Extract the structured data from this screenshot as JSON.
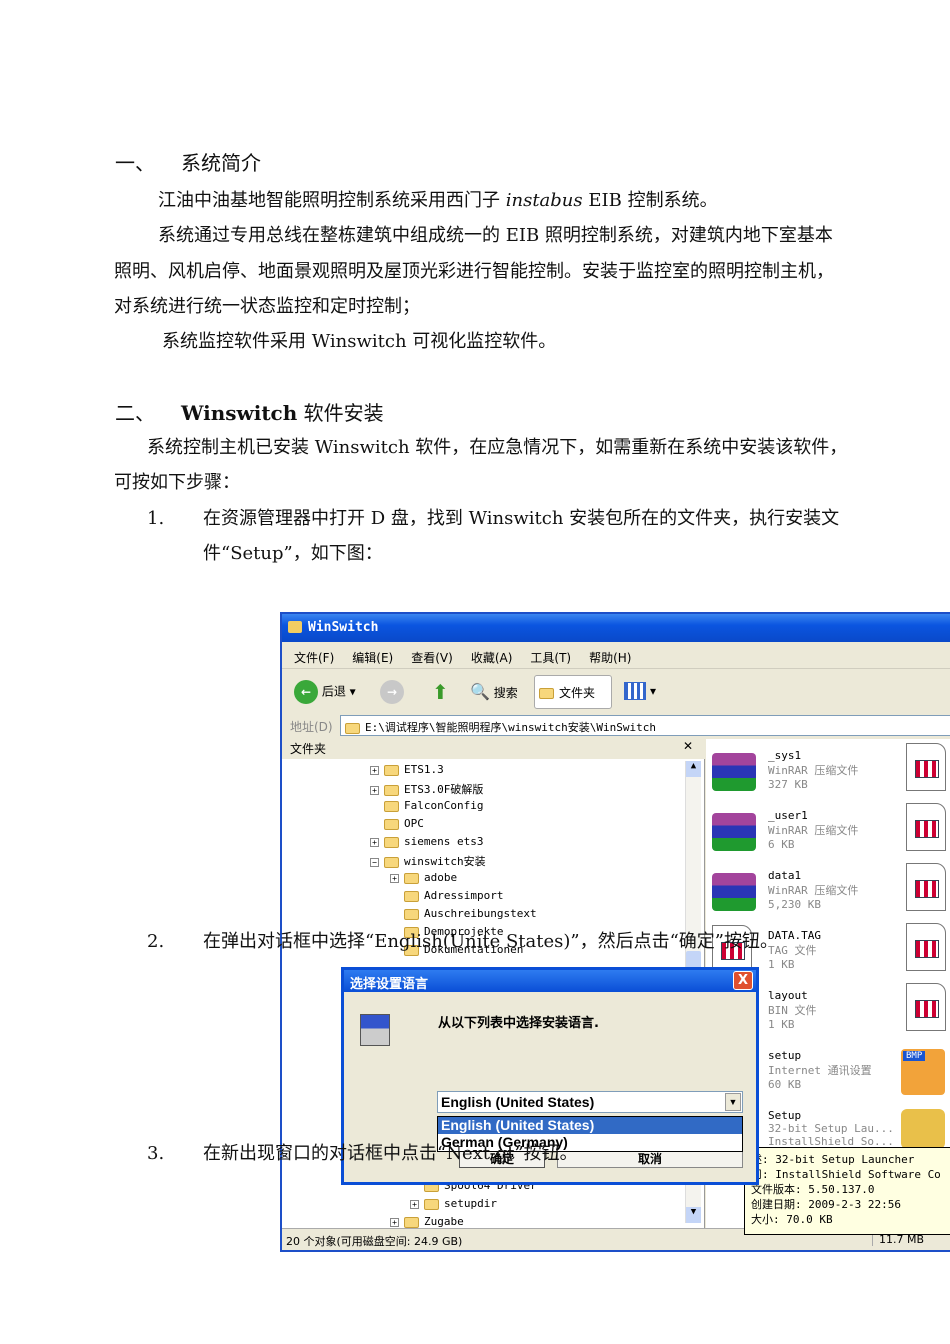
{
  "section1": {
    "num": "一、",
    "title": "系统简介",
    "p1_a": "江油中油基地智能照明控制系统采用西门子",
    "p1_i": "instabus",
    "p1_b": "EIB 控制系统。",
    "p2_l1": "系统通过专用总线在整栋建筑中组成统一的 EIB 照明控制系统，对建筑内地下室基本",
    "p2_l2": "照明、风机启停、地面景观照明及屋顶光彩进行智能控制。安装于监控室的照明控制主机，",
    "p2_l3": "对系统进行统一状态监控和定时控制；",
    "p3": "系统监控软件采用 Winswitch 可视化监控软件。"
  },
  "section2": {
    "num": "二、",
    "title_b": "Winswitch",
    "title": " 软件安装",
    "p1_l1": "系统控制主机已安装 Winswitch 软件，在应急情况下，如需重新在系统中安装该软件，",
    "p1_l2": "可按如下步骤：",
    "steps": [
      {
        "num": "1.",
        "l1": "在资源管理器中打开 D 盘，找到 Winswitch 安装包所在的文件夹，执行安装文",
        "l2": "件“Setup”，如下图："
      },
      {
        "num": "2.",
        "l1": "在弹出对话框中选择“English(Unite States)”，然后点击“确定”按钮。"
      },
      {
        "num": "3.",
        "l1": "在新出现窗口的对话框中点击“Next gt”按钮。"
      }
    ]
  },
  "explorer": {
    "title": "WinSwitch",
    "menu": [
      "文件(F)",
      "编辑(E)",
      "查看(V)",
      "收藏(A)",
      "工具(T)",
      "帮助(H)"
    ],
    "toolbar": {
      "back": "后退",
      "search": "搜索",
      "folders": "文件夹"
    },
    "address_label": "地址(D)",
    "address": "E:\\调试程序\\智能照明程序\\winswitch安装\\WinSwitch",
    "folders_pane_title": "文件夹",
    "tree": [
      {
        "label": "ETS1.3",
        "exp": "+",
        "lvl": 0
      },
      {
        "label": "ETS3.0F破解版",
        "exp": "+",
        "lvl": 0
      },
      {
        "label": "FalconConfig",
        "exp": "",
        "lvl": 0
      },
      {
        "label": "OPC",
        "exp": "",
        "lvl": 0
      },
      {
        "label": "siemens ets3",
        "exp": "+",
        "lvl": 0
      },
      {
        "label": "winswitch安装",
        "exp": "-",
        "lvl": 0
      },
      {
        "label": "adobe",
        "exp": "+",
        "lvl": 1
      },
      {
        "label": "Adressimport",
        "exp": "",
        "lvl": 1
      },
      {
        "label": "Auschreibungstext",
        "exp": "",
        "lvl": 1
      },
      {
        "label": "Demoprojekte",
        "exp": "",
        "lvl": 1
      },
      {
        "label": "Dokumentationen",
        "exp": "",
        "lvl": 1
      }
    ],
    "tree_bottom": [
      {
        "label": "Spool64 Driver",
        "exp": "",
        "lvl": 2
      },
      {
        "label": "setupdir",
        "exp": "+",
        "lvl": 2
      },
      {
        "label": "Zugabe",
        "exp": "+",
        "lvl": 1
      }
    ],
    "files": [
      {
        "name": "_sys1",
        "type": "WinRAR 压缩文件",
        "size": "327 KB",
        "icon": "rar"
      },
      {
        "name": "_user1",
        "type": "WinRAR 压缩文件",
        "size": "6 KB",
        "icon": "rar"
      },
      {
        "name": "data1",
        "type": "WinRAR 压缩文件",
        "size": "5,230 KB",
        "icon": "rar"
      },
      {
        "name": "DATA.TAG",
        "type": "TAG 文件",
        "size": "1 KB",
        "icon": "doc"
      },
      {
        "name": "layout",
        "type": "BIN 文件",
        "size": "1 KB",
        "icon": "doc"
      },
      {
        "name": "setup",
        "type": "Internet 通讯设置",
        "size": "60 KB",
        "icon": "bmp"
      },
      {
        "name": "Setup",
        "type": "32-bit Setup Lau...",
        "size": "InstallShield So...",
        "icon": "setup"
      }
    ],
    "bmp_badge": "BMP",
    "status_left": "20 个对象(可用磁盘空间: 24.9 GB)",
    "status_right": "11.7 MB",
    "tooltip": [
      "述: 32-bit Setup Launcher",
      "司: InstallShield Software Co",
      "文件版本: 5.50.137.0",
      "创建日期: 2009-2-3 22:56",
      "大小: 70.0 KB"
    ]
  },
  "dialog": {
    "title": "选择设置语言",
    "prompt": "从以下列表中选择安装语言.",
    "selected": "English (United States)",
    "options": [
      "English (United States)",
      "German (Germany)"
    ],
    "ok": "确定",
    "cancel": "取消",
    "close": "X"
  }
}
